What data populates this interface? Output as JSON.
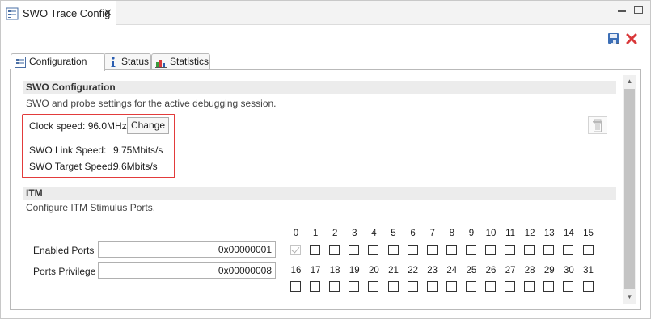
{
  "view": {
    "title": "SWO Trace Config",
    "close_glyph": "✕",
    "icons": [
      "config-icon",
      "minimize-icon",
      "maximize-icon",
      "save-icon",
      "delete-icon"
    ]
  },
  "tabs": [
    {
      "label": "Configuration",
      "icon": "config-icon",
      "active": true
    },
    {
      "label": "Status",
      "icon": "info-icon",
      "active": false
    },
    {
      "label": "Statistics",
      "icon": "statistics-icon",
      "active": false
    }
  ],
  "swo": {
    "title": "SWO Configuration",
    "description": "SWO and probe settings for the active debugging session.",
    "clock_label": "Clock speed: 96.0MHz",
    "change_label": "Change",
    "link_label": "SWO Link Speed:",
    "link_value": "9.75Mbits/s",
    "target_label": "SWO Target Speed:",
    "target_value": "9.6Mbits/s"
  },
  "itm": {
    "title": "ITM",
    "description": "Configure ITM Stimulus Ports.",
    "enabled_label": "Enabled Ports",
    "enabled_value": "0x00000001",
    "privilege_label": "Ports Privilege",
    "privilege_value": "0x00000008",
    "ports_row1": [
      "0",
      "1",
      "2",
      "3",
      "4",
      "5",
      "6",
      "7",
      "8",
      "9",
      "10",
      "11",
      "12",
      "13",
      "14",
      "15"
    ],
    "ports_row2": [
      "16",
      "17",
      "18",
      "19",
      "20",
      "21",
      "22",
      "23",
      "24",
      "25",
      "26",
      "27",
      "28",
      "29",
      "30",
      "31"
    ],
    "port0_checked_disabled": true
  },
  "colors": {
    "highlight_box": "#e23b3b",
    "section_header_bg": "#ececec",
    "delete_icon": "#d9383a",
    "save_icon": "#3d6fb6"
  }
}
